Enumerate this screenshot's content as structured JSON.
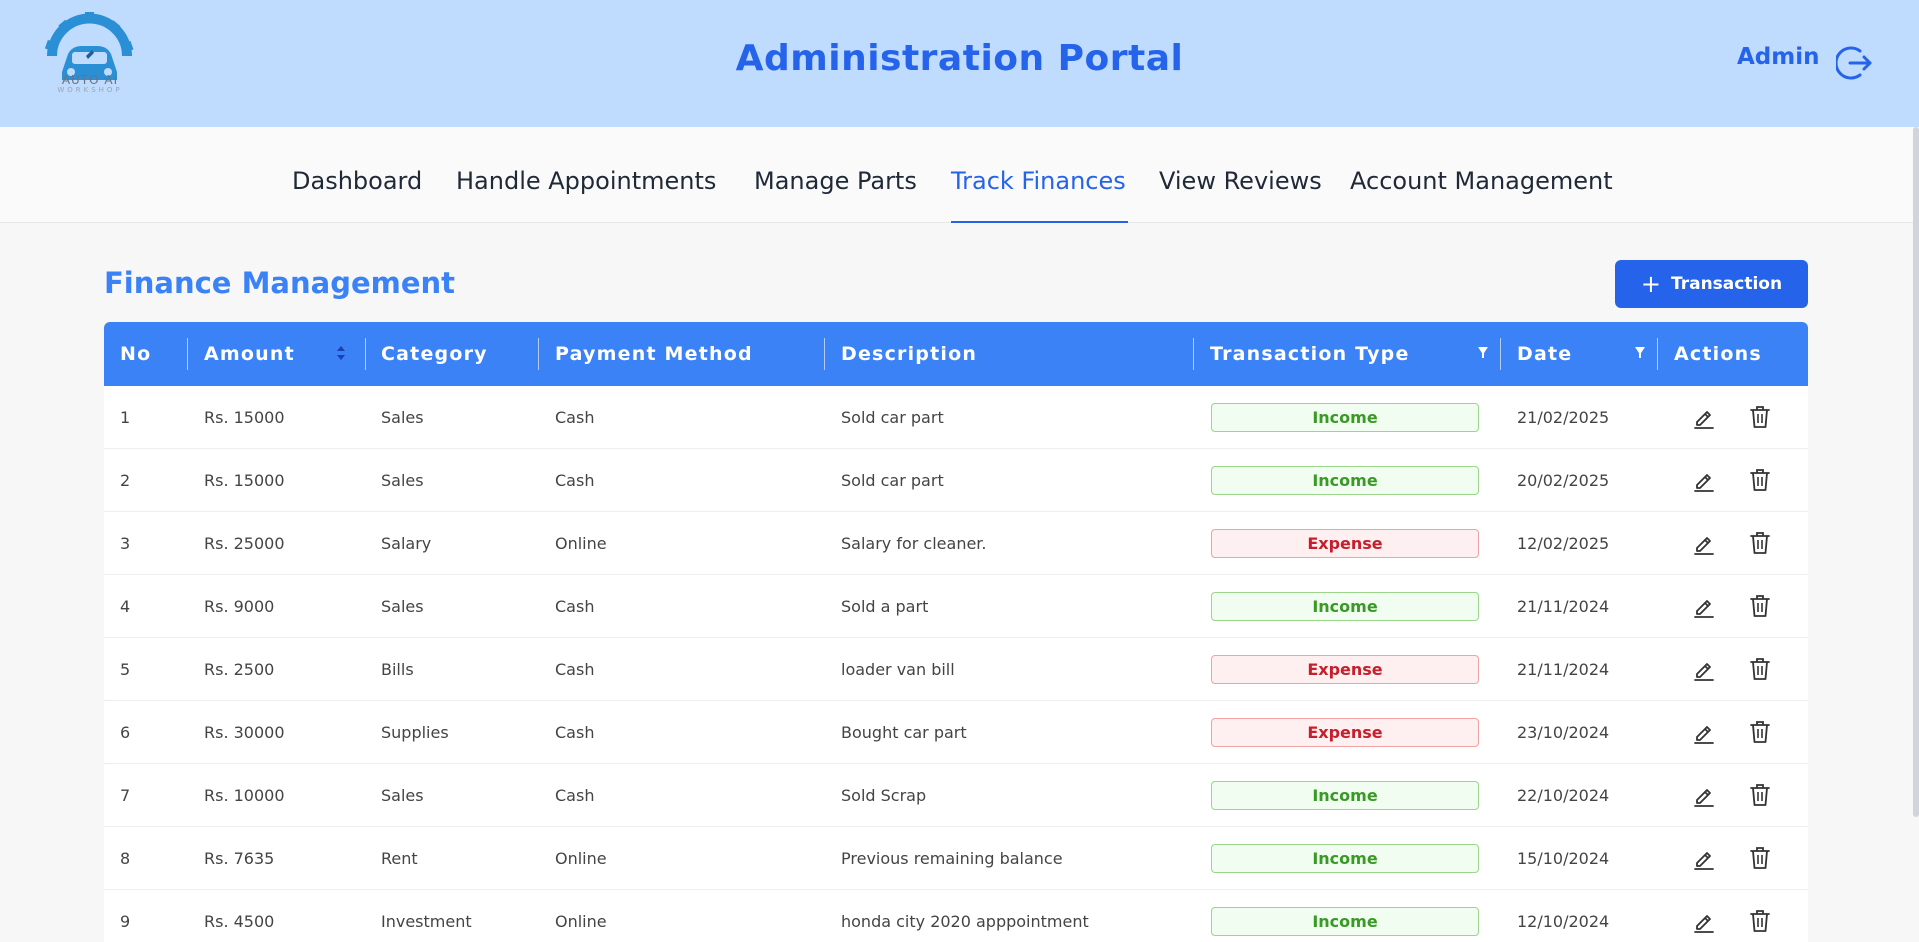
{
  "header": {
    "logo_text": "AUTO AI",
    "logo_sub": "WORKSHOP",
    "title": "Administration Portal",
    "user_label": "Admin",
    "logout_icon": "logout-icon"
  },
  "nav": {
    "items": [
      {
        "label": "Dashboard",
        "active": false
      },
      {
        "label": "Handle Appointments",
        "active": false
      },
      {
        "label": "Manage Parts",
        "active": false
      },
      {
        "label": "Track Finances",
        "active": true
      },
      {
        "label": "View Reviews",
        "active": false
      },
      {
        "label": "Account Management",
        "active": false
      }
    ]
  },
  "page": {
    "title": "Finance Management",
    "add_button_label": "Transaction",
    "add_button_icon": "plus-icon"
  },
  "table": {
    "columns": [
      "No",
      "Amount",
      "Category",
      "Payment Method",
      "Description",
      "Transaction Type",
      "Date",
      "Actions"
    ],
    "rows": [
      {
        "no": "1",
        "amount": "Rs. 15000",
        "category": "Sales",
        "method": "Cash",
        "description": "Sold car part",
        "type": "Income",
        "date": "21/02/2025"
      },
      {
        "no": "2",
        "amount": "Rs. 15000",
        "category": "Sales",
        "method": "Cash",
        "description": "Sold car part",
        "type": "Income",
        "date": "20/02/2025"
      },
      {
        "no": "3",
        "amount": "Rs. 25000",
        "category": "Salary",
        "method": "Online",
        "description": "Salary for cleaner.",
        "type": "Expense",
        "date": "12/02/2025"
      },
      {
        "no": "4",
        "amount": "Rs. 9000",
        "category": "Sales",
        "method": "Cash",
        "description": "Sold a part",
        "type": "Income",
        "date": "21/11/2024"
      },
      {
        "no": "5",
        "amount": "Rs. 2500",
        "category": "Bills",
        "method": "Cash",
        "description": "loader van bill",
        "type": "Expense",
        "date": "21/11/2024"
      },
      {
        "no": "6",
        "amount": "Rs. 30000",
        "category": "Supplies",
        "method": "Cash",
        "description": "Bought car part",
        "type": "Expense",
        "date": "23/10/2024"
      },
      {
        "no": "7",
        "amount": "Rs. 10000",
        "category": "Sales",
        "method": "Cash",
        "description": "Sold Scrap",
        "type": "Income",
        "date": "22/10/2024"
      },
      {
        "no": "8",
        "amount": "Rs. 7635",
        "category": "Rent",
        "method": "Online",
        "description": "Previous remaining balance",
        "type": "Income",
        "date": "15/10/2024"
      },
      {
        "no": "9",
        "amount": "Rs. 4500",
        "category": "Investment",
        "method": "Online",
        "description": "honda city 2020 apppointment",
        "type": "Income",
        "date": "12/10/2024"
      }
    ]
  },
  "colors": {
    "header_bg": "#bfdbfe",
    "accent": "#2563eb",
    "table_header": "#3b82f6",
    "income": "#3a9a26",
    "expense": "#c81e2c"
  }
}
